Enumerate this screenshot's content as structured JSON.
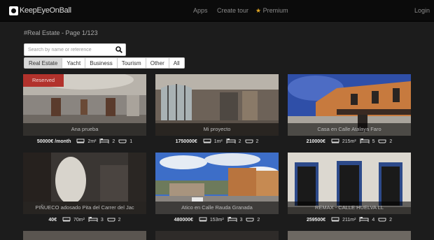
{
  "header": {
    "logo_text": "KeepEyeOnBall",
    "nav": {
      "apps": "Apps",
      "create_tour": "Create tour",
      "premium": "Premium",
      "login": "Login"
    },
    "premium_color": "#e0a524"
  },
  "page": {
    "heading": "#Real Estate - Page 1/123",
    "search": {
      "placeholder": "Search by name or reference",
      "value": ""
    },
    "tabs": [
      "Real Estate",
      "Yacht",
      "Business",
      "Tourism",
      "Other",
      "All"
    ],
    "active_tab": "Real Estate"
  },
  "listings": [
    {
      "caption": "Ana prueba",
      "price": "50000€ /month",
      "area": "2m²",
      "beds": "2",
      "baths": "1",
      "badge": "Reserved"
    },
    {
      "caption": "Mi proyecto",
      "price": "1750000€",
      "area": "1m²",
      "beds": "2",
      "baths": "2"
    },
    {
      "caption": "Casa en Calle Atalaya Faro",
      "price": "210000€",
      "area": "215m²",
      "beds": "5",
      "baths": "2"
    },
    {
      "caption": "PIÑUECO adosado Pita del Carrer del Jac",
      "price": "40€",
      "area": "70m²",
      "beds": "3",
      "baths": "2"
    },
    {
      "caption": "Atico en Calle Rauda Granada",
      "price": "480000€",
      "area": "153m²",
      "beds": "3",
      "baths": "2"
    },
    {
      "caption": "REMAX - CALLE HUELVA LL",
      "price": "259500€",
      "area": "211m²",
      "beds": "4",
      "baths": "2"
    }
  ],
  "icons": {
    "search": "search-icon",
    "area": "area-icon",
    "bed": "bed-icon",
    "bath": "bath-icon",
    "premium": "star-icon"
  },
  "colors": {
    "badge_reserved": "#b2322c",
    "topbar": "#0b0b0b",
    "background": "#1c1c1c"
  }
}
